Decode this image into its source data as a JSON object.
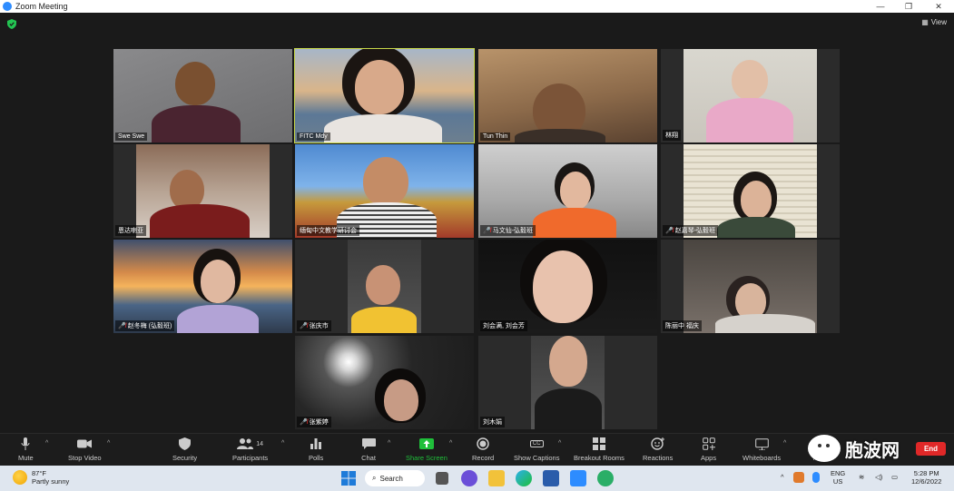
{
  "window": {
    "title": "Zoom Meeting",
    "controls": [
      "minimize",
      "restore",
      "close"
    ]
  },
  "view_button": {
    "label": "View"
  },
  "participants": [
    {
      "name": "Swe Swe",
      "muted": false,
      "active": false
    },
    {
      "name": "FITC Mdy",
      "muted": false,
      "active": true
    },
    {
      "name": "Tun Thin",
      "muted": false,
      "active": false
    },
    {
      "name": "林翔",
      "muted": false,
      "active": false
    },
    {
      "name": "恩达喇亚",
      "muted": false,
      "active": false
    },
    {
      "name": "缅甸中文教学研讨会",
      "muted": false,
      "active": false
    },
    {
      "name": "马文仙-弘毅班",
      "muted": true,
      "active": false
    },
    {
      "name": "赵嘉琴-弘毅班",
      "muted": true,
      "active": false
    },
    {
      "name": "赵冬梅 (弘毅班)",
      "muted": true,
      "active": false
    },
    {
      "name": "张庆市",
      "muted": true,
      "active": false
    },
    {
      "name": "刘会满, 刘会芳",
      "muted": false,
      "active": false
    },
    {
      "name": "陈丽中 福庆",
      "muted": false,
      "active": false
    },
    {
      "name": "张紫婷",
      "muted": true,
      "active": false
    },
    {
      "name": "刘木娟",
      "muted": false,
      "active": false
    }
  ],
  "toolbar": {
    "mute": "Mute",
    "stop_video": "Stop Video",
    "security": "Security",
    "participants": "Participants",
    "participants_count": "14",
    "polls": "Polls",
    "chat": "Chat",
    "share_screen": "Share Screen",
    "record": "Record",
    "show_captions": "Show Captions",
    "breakout_rooms": "Breakout Rooms",
    "reactions": "Reactions",
    "apps": "Apps",
    "whiteboards": "Whiteboards",
    "more": "Mo",
    "end": "End",
    "captions_icon_text": "CC"
  },
  "watermark": {
    "text": "胞波网"
  },
  "taskbar": {
    "temperature": "87°F",
    "weather": "Partly sunny",
    "search": "Search",
    "lang_top": "ENG",
    "lang_bottom": "US",
    "time": "5:28 PM",
    "date": "12/6/2022"
  },
  "colors": {
    "active_speaker": "#c8d94a",
    "share_green": "#1fbf3a",
    "end_red": "#e02828",
    "zoom_blue": "#2d8cff"
  }
}
